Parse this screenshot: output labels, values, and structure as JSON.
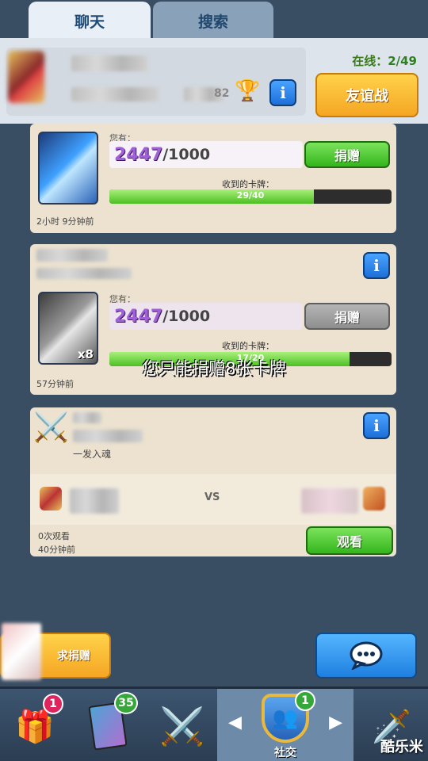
{
  "tabs": [
    {
      "label": "聊天",
      "active": true
    },
    {
      "label": "搜索",
      "active": false
    }
  ],
  "header": {
    "online_label": "在线：",
    "online_count": "2/49",
    "trophy_suffix": "82",
    "friendly_battle": "友谊战"
  },
  "donation_cards": [
    {
      "have_label": "您有：",
      "have_count": "2447",
      "have_total": "/1000",
      "button": "捐赠",
      "button_enabled": true,
      "received_label": "收到的卡牌：",
      "progress_text": "29/40",
      "progress": 0.725,
      "time": "2小时 9分钟前"
    },
    {
      "have_label": "您有：",
      "have_count": "2447",
      "have_total": "/1000",
      "button": "捐赠",
      "button_enabled": false,
      "card_badge": "x8",
      "received_label": "收到的卡牌：",
      "progress_text": "17/20",
      "progress": 0.85,
      "time": "57分钟前"
    }
  ],
  "toast": "您只能捐赠8张卡牌",
  "battle_card": {
    "subtitle": "一发入魂",
    "vs": "VS",
    "views": "0次观看",
    "time": "40分钟前",
    "watch_button": "观看"
  },
  "bottom": {
    "request_button": "求捐赠"
  },
  "nav": {
    "chest_badge": "1",
    "cards_badge": "35",
    "social_badge": "1",
    "social_label": "社交"
  },
  "watermark": "酷乐米",
  "colors": {
    "background": "#3a4e63",
    "accent_green": "#34b51c",
    "accent_orange": "#f5a623",
    "accent_blue": "#1f7fe0"
  }
}
